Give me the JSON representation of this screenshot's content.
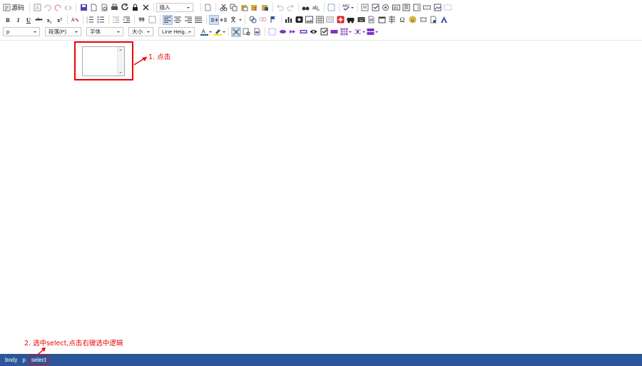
{
  "toolbar": {
    "source_label": "源码",
    "insert_dropdown": "插入",
    "format_dropdown": "p",
    "paragraph_dropdown": "段落(P)",
    "font_dropdown": "字体",
    "size_dropdown": "大小",
    "line_height_dropdown": "Line Heig...",
    "bold": "B",
    "italic": "I",
    "underline": "U",
    "strike": "abc",
    "subscript": "x₂",
    "superscript": "x²",
    "quote": "99",
    "special_char": "Ω",
    "accent_color": "#2b579a"
  },
  "annotations": {
    "step1": "1. 点击",
    "step2": "2. 选中select,点击右键选中逻辑",
    "highlight_color": "#ee0000"
  },
  "statusbar": {
    "crumbs": [
      "body",
      "p",
      "select"
    ]
  }
}
